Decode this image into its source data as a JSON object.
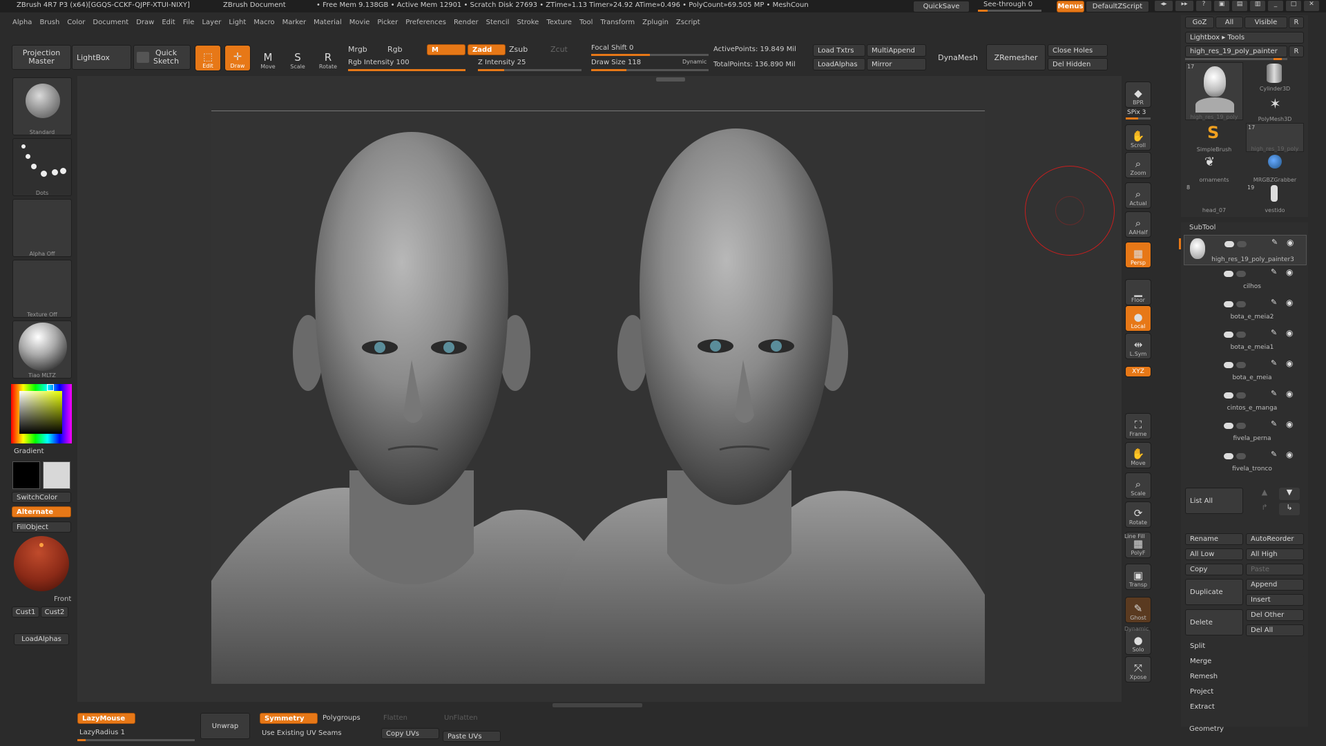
{
  "titlebar": {
    "app": "ZBrush 4R7 P3 (x64)[GGQS-CCKF-QJPF-XTUI-NIXY]",
    "doc": "ZBrush Document",
    "stats": "• Free Mem 9.138GB • Active Mem 12901 • Scratch Disk 27693 • ZTime»1.13 Timer»24.92 ATime»0.496 • PolyCount»69.505 MP • MeshCoun",
    "quicksave": "QuickSave",
    "seethrough": "See-through 0",
    "menus": "Menus",
    "script": "DefaultZScript"
  },
  "menubar": [
    "Alpha",
    "Brush",
    "Color",
    "Document",
    "Draw",
    "Edit",
    "File",
    "Layer",
    "Light",
    "Macro",
    "Marker",
    "Material",
    "Movie",
    "Picker",
    "Preferences",
    "Render",
    "Stencil",
    "Stroke",
    "Texture",
    "Tool",
    "Transform",
    "Zplugin",
    "Zscript"
  ],
  "toolbar": {
    "projection": "Projection\nMaster",
    "lightbox": "LightBox",
    "quick": "Quick\nSketch",
    "edit": "Edit",
    "draw": "Draw",
    "move": "Move",
    "scale": "Scale",
    "rotate": "Rotate",
    "mrgb": "Mrgb",
    "rgb": "Rgb",
    "m": "M",
    "zadd": "Zadd",
    "zsub": "Zsub",
    "zcut": "Zcut",
    "rgb_int": "Rgb Intensity 100",
    "z_int": "Z Intensity 25",
    "focal": "Focal Shift 0",
    "draw_size": "Draw Size 118",
    "dynamic": "Dynamic",
    "active_pts": "ActivePoints: 19.849 Mil",
    "total_pts": "TotalPoints: 136.890 Mil",
    "load_txtrs": "Load Txtrs",
    "load_alphas": "LoadAlphas",
    "multiappend": "MultiAppend",
    "mirror": "Mirror",
    "dynamesh": "DynaMesh",
    "zremesher": "ZRemesher",
    "close_holes": "Close Holes",
    "del_hidden": "Del Hidden",
    "progress": {
      "rgb_int": 1.0,
      "z_int": 0.25,
      "focal": 0.5,
      "draw_size": 0.3
    }
  },
  "left": {
    "brush": "Standard",
    "stroke": "Dots",
    "alpha": "Alpha Off",
    "texture": "Texture Off",
    "material": "Tiao MLTZ",
    "gradient": "Gradient",
    "switchcolor": "SwitchColor",
    "alternate": "Alternate",
    "fillobject": "FillObject",
    "front": "Front",
    "cust1": "Cust1",
    "cust2": "Cust2",
    "loadalphas": "LoadAlphas"
  },
  "rightshelf": [
    {
      "name": "bpr-button",
      "label": "BPR",
      "icon": "◆"
    },
    {
      "name": "scroll-button",
      "label": "Scroll",
      "icon": "✋"
    },
    {
      "name": "zoom-button",
      "label": "Zoom",
      "icon": "⌕"
    },
    {
      "name": "actual-button",
      "label": "Actual",
      "icon": "⌕"
    },
    {
      "name": "aahalf-button",
      "label": "AAHalf",
      "icon": "⌕"
    },
    {
      "name": "persp-button",
      "label": "Persp",
      "icon": "▦"
    },
    {
      "name": "floor-button",
      "label": "Floor",
      "icon": "▁"
    },
    {
      "name": "local-button",
      "label": "Local",
      "icon": "●"
    },
    {
      "name": "lsym-button",
      "label": "L.Sym",
      "icon": "⇹"
    },
    {
      "name": "xyz-button",
      "label": "XYZ",
      "icon": ""
    },
    {
      "name": "frame-button",
      "label": "Frame",
      "icon": "⛶"
    },
    {
      "name": "move-view-button",
      "label": "Move",
      "icon": "✋"
    },
    {
      "name": "scale-view-button",
      "label": "Scale",
      "icon": "⌕"
    },
    {
      "name": "rotate-view-button",
      "label": "Rotate",
      "icon": "⟳"
    },
    {
      "name": "polyf-button",
      "label": "PolyF",
      "icon": "▦"
    },
    {
      "name": "transp-button",
      "label": "Transp",
      "icon": "▣"
    },
    {
      "name": "ghost-button",
      "label": "Ghost",
      "icon": "✎"
    },
    {
      "name": "solo-button",
      "label": "Solo",
      "icon": "●"
    },
    {
      "name": "xpose-button",
      "label": "Xpose",
      "icon": "⤧"
    }
  ],
  "spix": "SPix 3",
  "linefill": "Line Fill",
  "dynamic_small": "Dynamic",
  "tool": {
    "goz": "GoZ",
    "all": "All",
    "visible": "Visible",
    "r": "R",
    "lightbox_tools": "Lightbox ▸ Tools",
    "current": "high_res_19_poly_painter",
    "r2": "R",
    "count1": "17",
    "count2": "17",
    "count3": "8",
    "count4": "19",
    "thumbs": [
      "high_res_19_poly",
      "Cylinder3D",
      "PolyMesh3D",
      "SimpleBrush",
      "high_res_19_poly",
      "ornaments",
      "MRGBZGrabber",
      "head_07",
      "vestido"
    ]
  },
  "subtool": {
    "title": "SubTool",
    "items": [
      "high_res_19_poly_painter3",
      "cilhos",
      "bota_e_meia2",
      "bota_e_meia1",
      "bota_e_meia",
      "cintos_e_manga",
      "fivela_perna",
      "fivela_tronco"
    ],
    "list_all": "List All",
    "rename": "Rename",
    "autoreorder": "AutoReorder",
    "all_low": "All Low",
    "all_high": "All High",
    "copy": "Copy",
    "paste": "Paste",
    "duplicate": "Duplicate",
    "append": "Append",
    "insert": "Insert",
    "del_other": "Del Other",
    "delete": "Delete",
    "del_all": "Del All",
    "split": "Split",
    "merge": "Merge",
    "remesh": "Remesh",
    "project": "Project",
    "extract": "Extract",
    "geometry": "Geometry"
  },
  "bottom": {
    "lazymouse": "LazyMouse",
    "lazyradius": "LazyRadius 1",
    "unwrap": "Unwrap",
    "symmetry": "Symmetry",
    "polygroups": "Polygroups",
    "flatten": "Flatten",
    "unflatten": "UnFlatten",
    "use_uv": "Use Existing UV Seams",
    "copy_uvs": "Copy UVs",
    "paste_uvs": "Paste UVs"
  },
  "colors": {
    "accent": "#e77817",
    "bg": "#2b2b2b",
    "panel": "#393939",
    "canvas": "#323232",
    "brush_ring": "#c81e1e"
  }
}
